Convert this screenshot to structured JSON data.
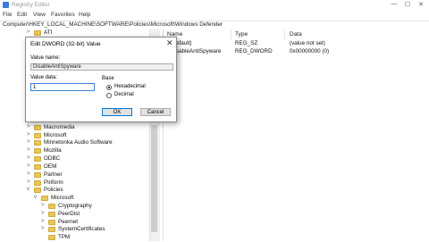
{
  "window": {
    "title": "Registry Editor",
    "controls": [
      "—",
      "☐",
      "✕"
    ]
  },
  "menu": [
    "File",
    "Edit",
    "View",
    "Favorites",
    "Help"
  ],
  "address": "Computer\\HKEY_LOCAL_MACHINE\\SOFTWARE\\Policies\\Microsoft\\Windows Defender",
  "tree": {
    "items": [
      {
        "label": "ATI",
        "level": 1,
        "chevron": ">"
      },
      {
        "label": "Macromedia",
        "level": 1,
        "chevron": ">"
      },
      {
        "label": "Microsoft",
        "level": 1,
        "chevron": ">"
      },
      {
        "label": "Minnetonka Audio Software",
        "level": 1,
        "chevron": ">"
      },
      {
        "label": "Mozilla",
        "level": 1,
        "chevron": ">"
      },
      {
        "label": "ODBC",
        "level": 1,
        "chevron": ">"
      },
      {
        "label": "OEM",
        "level": 1,
        "chevron": ">"
      },
      {
        "label": "Partner",
        "level": 1,
        "chevron": ">"
      },
      {
        "label": "Piriform",
        "level": 1,
        "chevron": ">"
      },
      {
        "label": "Policies",
        "level": 1,
        "chevron": "v"
      },
      {
        "label": "Microsoft",
        "level": 2,
        "chevron": "v"
      },
      {
        "label": "Cryptography",
        "level": 3,
        "chevron": ">"
      },
      {
        "label": "PeerDist",
        "level": 3,
        "chevron": ">"
      },
      {
        "label": "Peernet",
        "level": 3,
        "chevron": ">"
      },
      {
        "label": "SystemCertificates",
        "level": 3,
        "chevron": ">"
      },
      {
        "label": "TPM",
        "level": 3,
        "chevron": ""
      }
    ]
  },
  "values_pane": {
    "columns": [
      "Name",
      "Type",
      "Data"
    ],
    "rows": [
      {
        "name": "(Default)",
        "visible_name": "efault)",
        "type": "REG_SZ",
        "data": "(value not set)"
      },
      {
        "name": "DisableAntiSpyware",
        "visible_name": "sableAntiSpyware",
        "type": "REG_DWORD",
        "data": "0x00000000 (0)"
      }
    ]
  },
  "dialog": {
    "title": "Edit DWORD (32-bit) Value",
    "close": "✕",
    "value_name_label": "Value name:",
    "value_name": "DisableAntiSpyware",
    "value_data_label": "Value data:",
    "value_data": "1",
    "base_label": "Base",
    "base_options": [
      {
        "label": "Hexadecimal",
        "selected": true
      },
      {
        "label": "Decimal",
        "selected": false
      }
    ],
    "ok_label": "OK",
    "cancel_label": "Cancel"
  },
  "colors": {
    "accent": "#0078d7",
    "folder": "#e8c75a",
    "dialog_border": "#8a8a8a"
  }
}
